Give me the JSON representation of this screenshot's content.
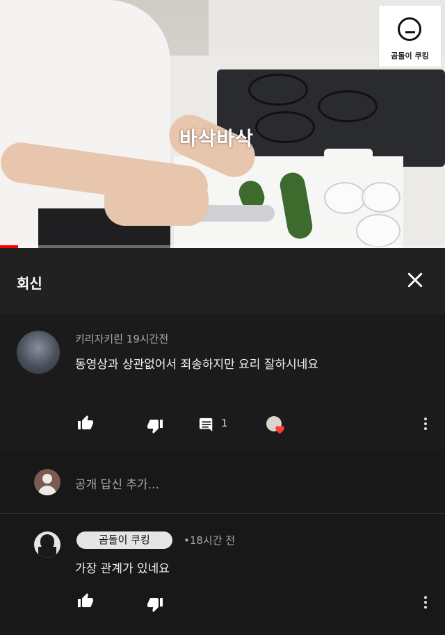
{
  "video": {
    "caption": "바삭바삭",
    "channel_logo_text": "곰돌이 쿠킹",
    "progress_fraction": 0.04
  },
  "panel": {
    "title": "회신",
    "close_icon": "close-icon"
  },
  "comment": {
    "author": "키리자키린",
    "time": "19시간전",
    "text": "동영상과 상관없어서 죄송하지만 요리 잘하시네요",
    "reply_count": "1",
    "icons": [
      "thumb-up-icon",
      "thumb-down-icon",
      "reply-icon",
      "creator-heart-icon",
      "more-vert-icon"
    ]
  },
  "reply_input": {
    "placeholder": "공개 답신 추가..."
  },
  "reply": {
    "author_badge": "곰돌이 쿠킹",
    "time": "•18시간 전",
    "text": "가장 관계가 있네요",
    "icons": [
      "thumb-up-icon",
      "thumb-down-icon",
      "more-vert-icon"
    ]
  },
  "colors": {
    "background": "#181818",
    "header": "#212121",
    "progress": "#ff0000",
    "heart": "#ff3b3b"
  }
}
